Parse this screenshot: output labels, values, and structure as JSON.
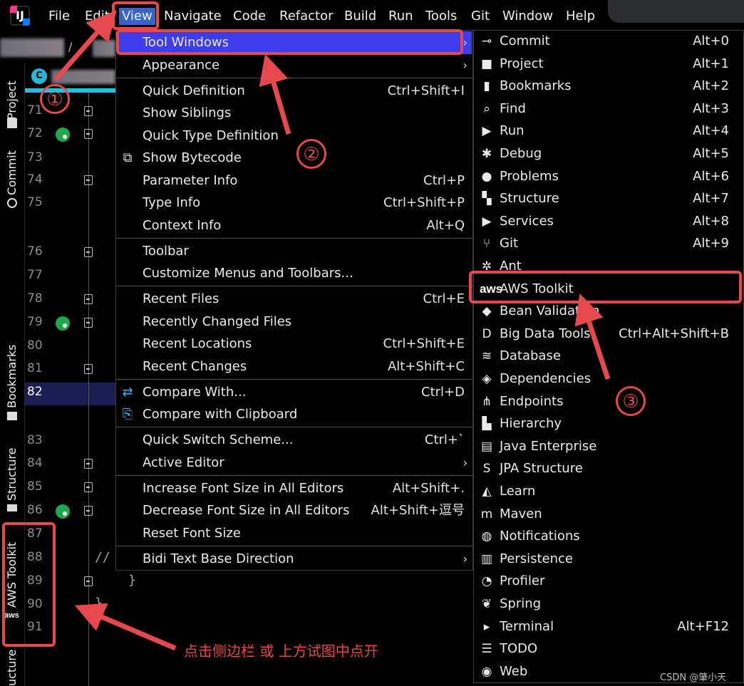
{
  "menubar": {
    "items": [
      {
        "label": "File"
      },
      {
        "label": "Edit"
      },
      {
        "label": "View"
      },
      {
        "label": "Navigate"
      },
      {
        "label": "Code"
      },
      {
        "label": "Refactor"
      },
      {
        "label": "Build"
      },
      {
        "label": "Run"
      },
      {
        "label": "Tools"
      },
      {
        "label": "Git"
      },
      {
        "label": "Window"
      },
      {
        "label": "Help"
      }
    ],
    "active": "View"
  },
  "side_stripe": {
    "project": "Project",
    "commit": "Commit",
    "bookmarks": "Bookmarks",
    "structure": "Structure",
    "aws_toolkit": "AWS Toolkit",
    "structure_bottom": "ucture"
  },
  "editor": {
    "tab_letter": "C",
    "line_numbers": [
      "71",
      "72",
      "73",
      "74",
      "75",
      "76",
      "77",
      "78",
      "79",
      "80",
      "81",
      "82",
      "83",
      "84",
      "85",
      "86",
      "87",
      "88",
      "89",
      "90",
      "91"
    ],
    "current_line": "82",
    "code_comment": "//",
    "code_brace": "}",
    "code_brace2": "}"
  },
  "view_menu": {
    "items": [
      {
        "label": "Tool Windows",
        "shortcut": "",
        "submenu": true
      },
      {
        "label": "Appearance",
        "shortcut": "",
        "submenu": true
      },
      {
        "label": "Quick Definition",
        "shortcut": "Ctrl+Shift+I"
      },
      {
        "label": "Show Siblings",
        "shortcut": ""
      },
      {
        "label": "Quick Type Definition",
        "shortcut": ""
      },
      {
        "label": "Show Bytecode",
        "shortcut": ""
      },
      {
        "label": "Parameter Info",
        "shortcut": "Ctrl+P"
      },
      {
        "label": "Type Info",
        "shortcut": "Ctrl+Shift+P"
      },
      {
        "label": "Context Info",
        "shortcut": "Alt+Q"
      },
      {
        "label": "Toolbar",
        "shortcut": ""
      },
      {
        "label": "Customize Menus and Toolbars...",
        "shortcut": ""
      },
      {
        "label": "Recent Files",
        "shortcut": "Ctrl+E"
      },
      {
        "label": "Recently Changed Files",
        "shortcut": ""
      },
      {
        "label": "Recent Locations",
        "shortcut": "Ctrl+Shift+E"
      },
      {
        "label": "Recent Changes",
        "shortcut": "Alt+Shift+C"
      },
      {
        "label": "Compare With...",
        "shortcut": "Ctrl+D"
      },
      {
        "label": "Compare with Clipboard",
        "shortcut": ""
      },
      {
        "label": "Quick Switch Scheme...",
        "shortcut": "Ctrl+`"
      },
      {
        "label": "Active Editor",
        "shortcut": "",
        "submenu": true
      },
      {
        "label": "Increase Font Size in All Editors",
        "shortcut": "Alt+Shift+."
      },
      {
        "label": "Decrease Font Size in All Editors",
        "shortcut": "Alt+Shift+逗号"
      },
      {
        "label": "Reset Font Size",
        "shortcut": ""
      },
      {
        "label": "Bidi Text Base Direction",
        "shortcut": "",
        "submenu": true
      }
    ]
  },
  "tool_windows_menu": {
    "items": [
      {
        "label": "Commit",
        "shortcut": "Alt+0",
        "icon": "commit-icon"
      },
      {
        "label": "Project",
        "shortcut": "Alt+1",
        "icon": "folder-icon"
      },
      {
        "label": "Bookmarks",
        "shortcut": "Alt+2",
        "icon": "bookmark-icon"
      },
      {
        "label": "Find",
        "shortcut": "Alt+3",
        "icon": "search-icon"
      },
      {
        "label": "Run",
        "shortcut": "Alt+4",
        "icon": "play-icon"
      },
      {
        "label": "Debug",
        "shortcut": "Alt+5",
        "icon": "bug-icon"
      },
      {
        "label": "Problems",
        "shortcut": "Alt+6",
        "icon": "alert-icon"
      },
      {
        "label": "Structure",
        "shortcut": "Alt+7",
        "icon": "structure-icon"
      },
      {
        "label": "Services",
        "shortcut": "Alt+8",
        "icon": "services-icon"
      },
      {
        "label": "Git",
        "shortcut": "Alt+9",
        "icon": "git-branch-icon"
      },
      {
        "label": "Ant",
        "shortcut": "",
        "icon": "ant-icon"
      },
      {
        "label": "AWS Toolkit",
        "shortcut": "",
        "icon": "aws-icon"
      },
      {
        "label": "Bean Validation",
        "shortcut": "",
        "icon": "bean-validation-icon"
      },
      {
        "label": "Big Data Tools",
        "shortcut": "Ctrl+Alt+Shift+B",
        "icon": "big-data-icon"
      },
      {
        "label": "Database",
        "shortcut": "",
        "icon": "database-icon"
      },
      {
        "label": "Dependencies",
        "shortcut": "",
        "icon": "layers-icon"
      },
      {
        "label": "Endpoints",
        "shortcut": "",
        "icon": "endpoints-icon"
      },
      {
        "label": "Hierarchy",
        "shortcut": "",
        "icon": "hierarchy-icon"
      },
      {
        "label": "Java Enterprise",
        "shortcut": "",
        "icon": "java-enterprise-icon"
      },
      {
        "label": "JPA Structure",
        "shortcut": "",
        "icon": "jpa-icon"
      },
      {
        "label": "Learn",
        "shortcut": "",
        "icon": "graduation-cap-icon"
      },
      {
        "label": "Maven",
        "shortcut": "",
        "icon": "maven-icon"
      },
      {
        "label": "Notifications",
        "shortcut": "",
        "icon": "bell-icon"
      },
      {
        "label": "Persistence",
        "shortcut": "",
        "icon": "persistence-icon"
      },
      {
        "label": "Profiler",
        "shortcut": "",
        "icon": "profiler-icon"
      },
      {
        "label": "Spring",
        "shortcut": "",
        "icon": "spring-leaf-icon"
      },
      {
        "label": "Terminal",
        "shortcut": "Alt+F12",
        "icon": "terminal-icon"
      },
      {
        "label": "TODO",
        "shortcut": "",
        "icon": "list-icon"
      },
      {
        "label": "Web",
        "shortcut": "",
        "icon": "globe-icon"
      }
    ]
  },
  "annotations": {
    "step1": "①",
    "step2": "②",
    "step3": "③",
    "note": "点击侧边栏 或 上方试图中点开",
    "aws_logo_text": "aws"
  },
  "watermark": "CSDN @肇小天",
  "colors": {
    "highlight": "#3d3ded",
    "annotation_red": "#e5484d",
    "current_line_bg": "#1c1d54",
    "tab_accent": "#25c0dd"
  }
}
